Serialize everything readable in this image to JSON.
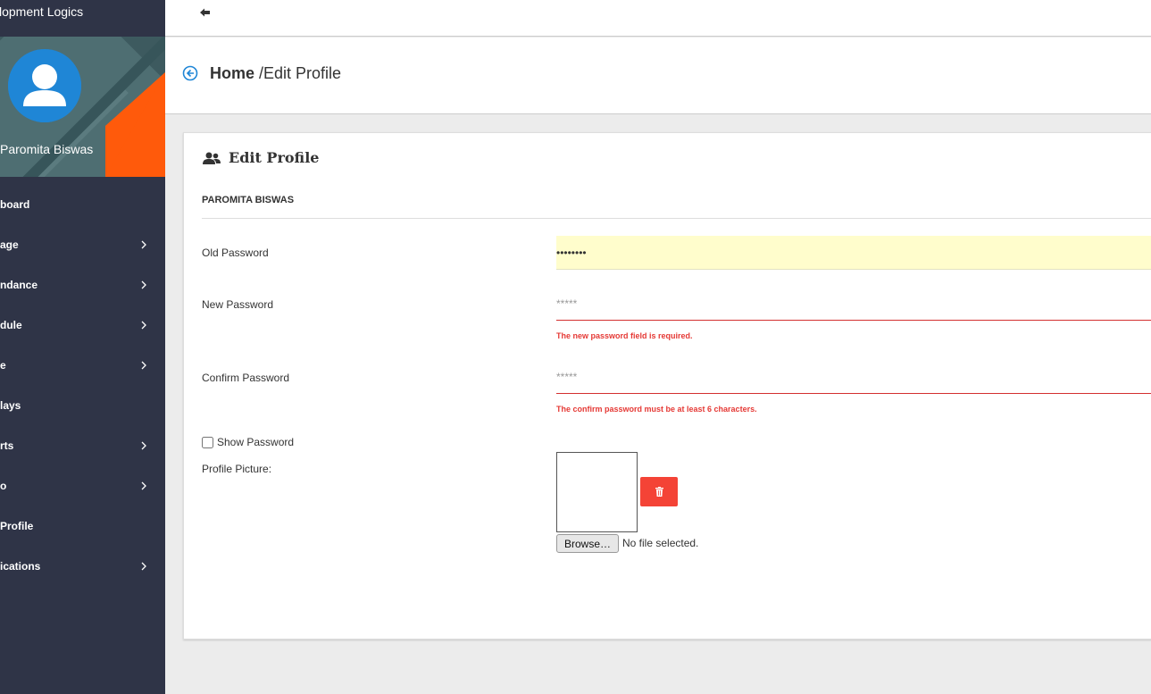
{
  "brand": {
    "title": "lopment Logics"
  },
  "profile": {
    "name": "Paromita Biswas"
  },
  "sidebar": {
    "items": [
      {
        "label": "board",
        "has_children": false
      },
      {
        "label": "age",
        "has_children": true
      },
      {
        "label": "ndance",
        "has_children": true
      },
      {
        "label": "dule",
        "has_children": true
      },
      {
        "label": "e",
        "has_children": true
      },
      {
        "label": "lays",
        "has_children": false
      },
      {
        "label": "rts",
        "has_children": true
      },
      {
        "label": "o",
        "has_children": true
      },
      {
        "label": "Profile",
        "has_children": false
      },
      {
        "label": "ications",
        "has_children": true
      }
    ]
  },
  "breadcrumb": {
    "home": "Home",
    "current": "/Edit Profile"
  },
  "card": {
    "title": "Edit Profile",
    "user_name": "PAROMITA BISWAS"
  },
  "form": {
    "old_password": {
      "label": "Old Password",
      "value": "••••••••"
    },
    "new_password": {
      "label": "New Password",
      "placeholder": "*****",
      "error": "The new password field is required."
    },
    "confirm_password": {
      "label": "Confirm Password",
      "placeholder": "*****",
      "error": "The confirm password must be at least 6 characters."
    },
    "show_password": {
      "label": "Show Password",
      "checked": false
    },
    "profile_picture": {
      "label": "Profile Picture:",
      "browse_label": "Browse…",
      "file_status": "No file selected."
    }
  },
  "colors": {
    "sidebar_bg": "#2f3447",
    "accent_orange": "#ff5a0b",
    "avatar_blue": "#1f86d6",
    "error_red": "#e53935",
    "delete_red": "#f44336"
  }
}
